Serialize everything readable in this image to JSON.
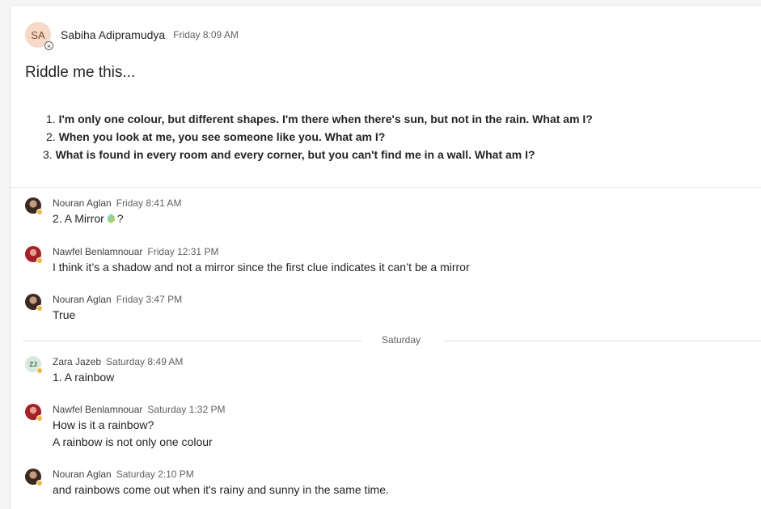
{
  "root_post": {
    "avatar_initials": "SA",
    "avatar_status": "blocked",
    "author": "Sabiha Adipramudya",
    "time": "Friday 8:09 AM",
    "title": "Riddle me this...",
    "riddles": [
      {
        "num": "1.",
        "text": "I'm only one colour, but different shapes. I'm there when there's sun, but not in the rain. What am I?"
      },
      {
        "num": "2.",
        "text": "When you look at me, you see someone like you. What am I?"
      },
      {
        "num": "3.",
        "text": "What is found in every room and every corner, but you can't find me in a wall. What am I?"
      }
    ]
  },
  "replies": [
    {
      "author": "Nouran Aglan",
      "time": "Friday 8:41 AM",
      "lines": [
        "2. A Mirror",
        "?"
      ],
      "avatar": "photo"
    },
    {
      "author": "Nawfel Benlamnouar",
      "time": "Friday 12:31 PM",
      "lines": [
        "I think it’s a shadow and not a mirror since the first clue indicates it can’t be a mirror"
      ],
      "avatar": "photo"
    },
    {
      "author": "Nouran Aglan",
      "time": "Friday 3:47 PM",
      "lines": [
        "True"
      ],
      "avatar": "photo"
    },
    {
      "author": "Zara Jazeb",
      "time": "Saturday 8:49 AM",
      "lines": [
        "1. A rainbow"
      ],
      "avatar_initials": "ZJ"
    },
    {
      "author": "Nawfel Benlamnouar",
      "time": "Saturday 1:32 PM",
      "lines": [
        "How is it a rainbow?",
        "A rainbow is not only one colour"
      ],
      "avatar": "photo"
    },
    {
      "author": "Nouran Aglan",
      "time": "Saturday 2:10 PM",
      "lines": [
        "and rainbows come out when it's rainy and sunny in the same time."
      ],
      "avatar": "photo"
    }
  ],
  "day_separator": "Saturday",
  "colors": {
    "presence_away": "#f7b733",
    "card_bg": "#ffffff"
  }
}
